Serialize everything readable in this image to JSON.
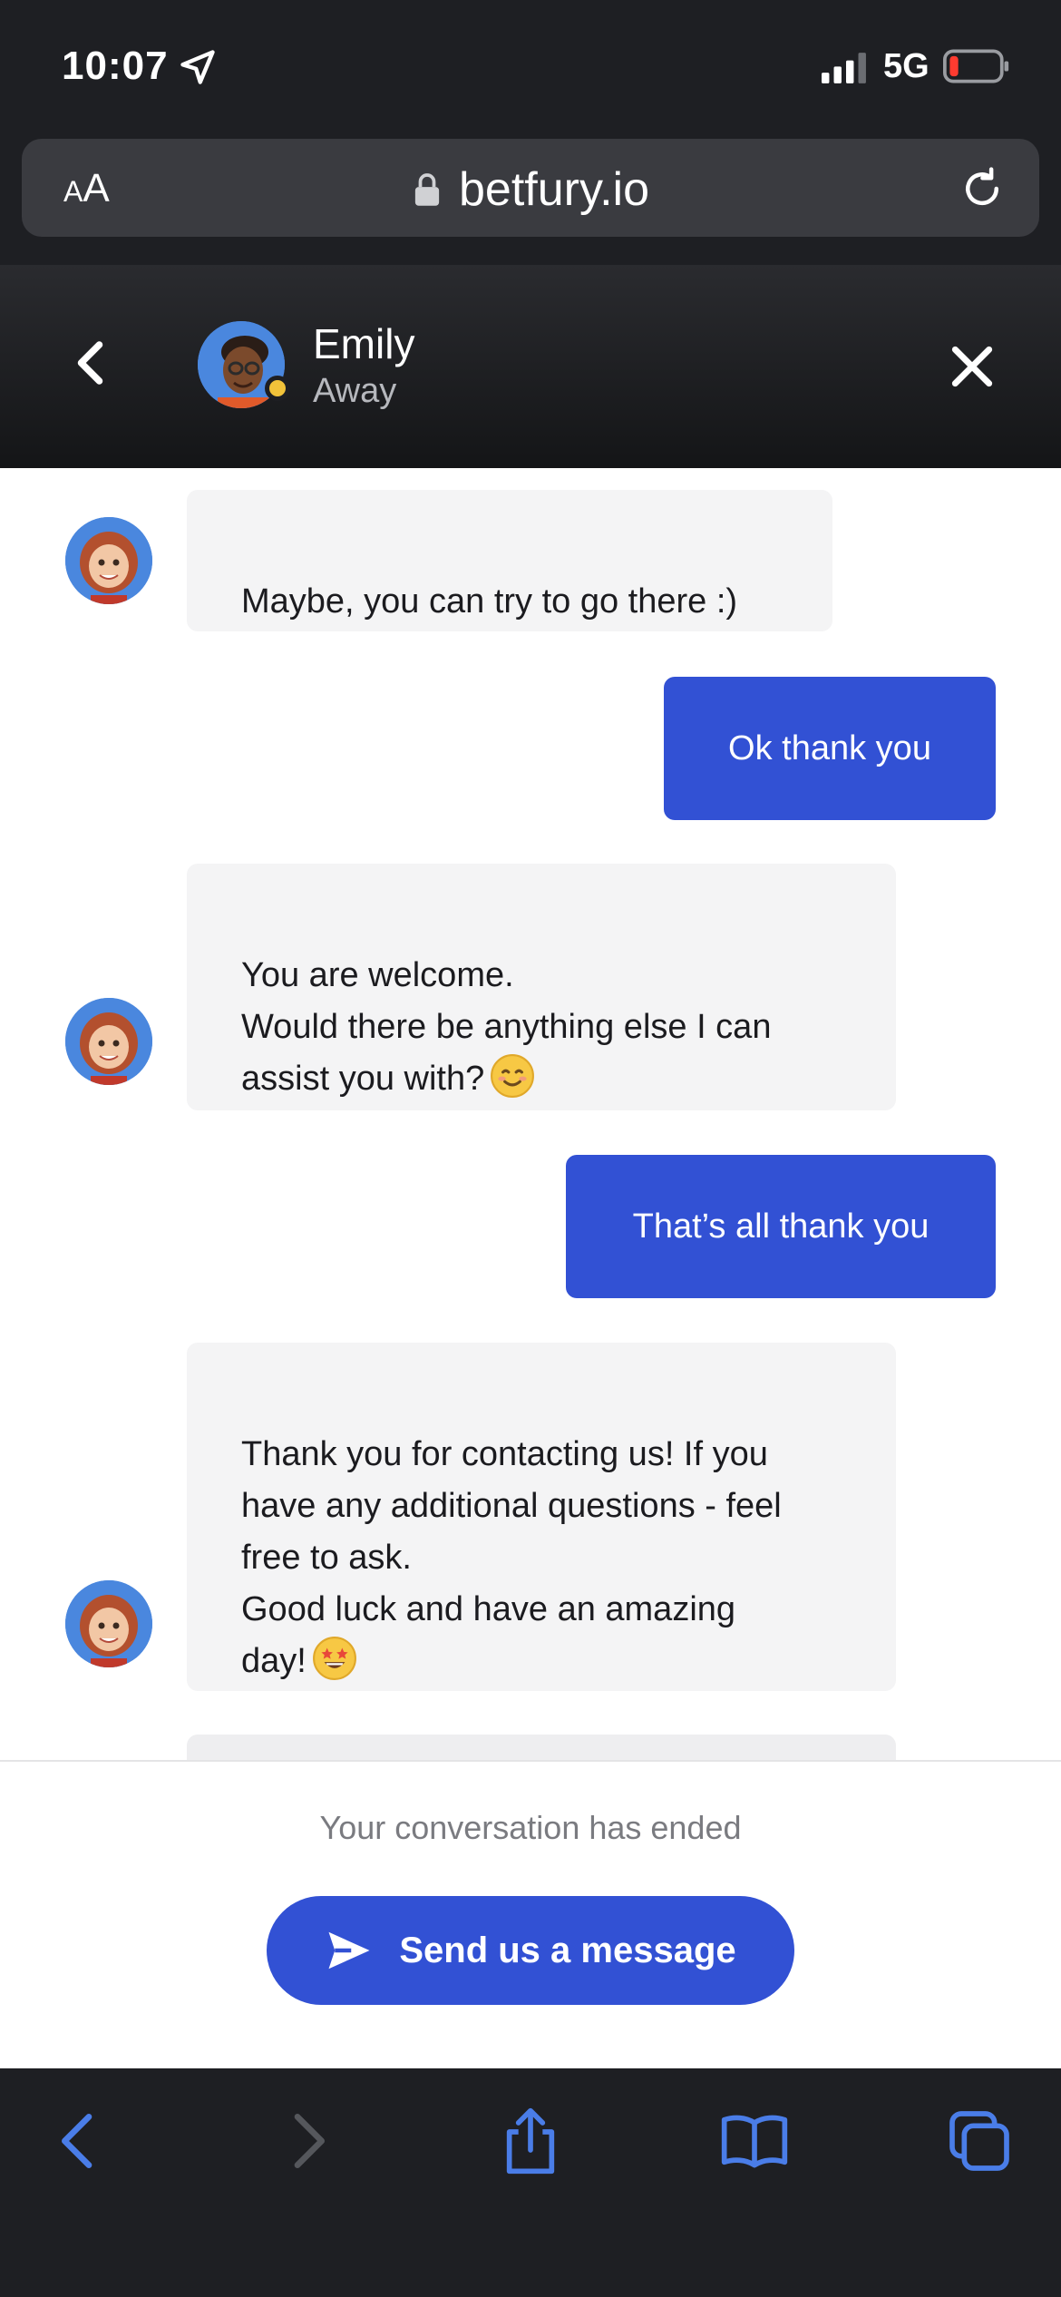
{
  "status_bar": {
    "time": "10:07",
    "network": "5G"
  },
  "browser": {
    "text_size_label": "AA",
    "domain": "betfury.io"
  },
  "chat_header": {
    "agent_name": "Emily",
    "agent_status": "Away"
  },
  "messages": [
    {
      "sender": "agent",
      "text": "Maybe, you can try to go there :)"
    },
    {
      "sender": "user",
      "text": "Ok thank you"
    },
    {
      "sender": "agent",
      "text": "You are welcome.\nWould there be anything else I can\nassist you with?",
      "emoji": "smiling-face-icon"
    },
    {
      "sender": "user",
      "text": "That’s all thank you"
    },
    {
      "sender": "agent",
      "text": "Thank you for contacting us! If you\nhave any additional questions - feel\nfree to ask.\nGood luck and have an amazing\nday!",
      "emoji": "star-struck-icon"
    }
  ],
  "footer": {
    "ended_text": "Your conversation has ended",
    "send_button_label": "Send us a message"
  },
  "colors": {
    "accent": "#3251d4",
    "agent_bubble": "#f4f4f5",
    "status_away": "#f2c33a",
    "toolbar_icon": "#4a7de8"
  }
}
